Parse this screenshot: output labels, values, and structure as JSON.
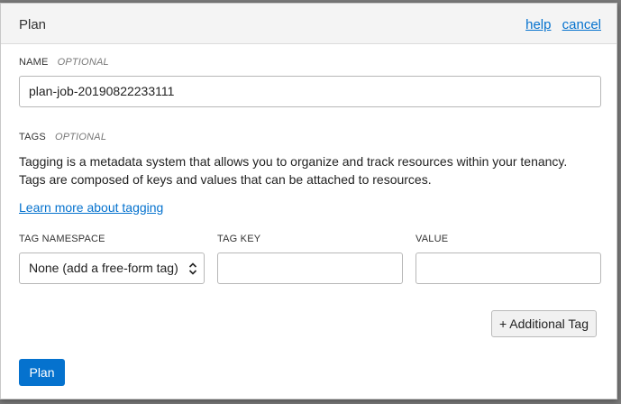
{
  "dialog": {
    "title": "Plan",
    "help_link": "help",
    "cancel_link": "cancel"
  },
  "name_section": {
    "label": "NAME",
    "optional": "OPTIONAL",
    "value": "plan-job-20190822233111"
  },
  "tags_section": {
    "label": "TAGS",
    "optional": "OPTIONAL",
    "description_line1": "Tagging is a metadata system that allows you to organize and track resources within your tenancy.",
    "description_line2": "Tags are composed of keys and values that can be attached to resources.",
    "learn_more": "Learn more about tagging",
    "columns": {
      "namespace": "TAG NAMESPACE",
      "key": "TAG KEY",
      "value": "VALUE"
    },
    "namespace_selected": "None (add a free-form tag)",
    "key_value": "",
    "value_value": "",
    "additional_button": "+ Additional Tag"
  },
  "footer": {
    "primary_button": "Plan"
  },
  "colors": {
    "accent": "#0572ce",
    "header_bg": "#f4f4f4",
    "backdrop": "#7a7a7a"
  }
}
